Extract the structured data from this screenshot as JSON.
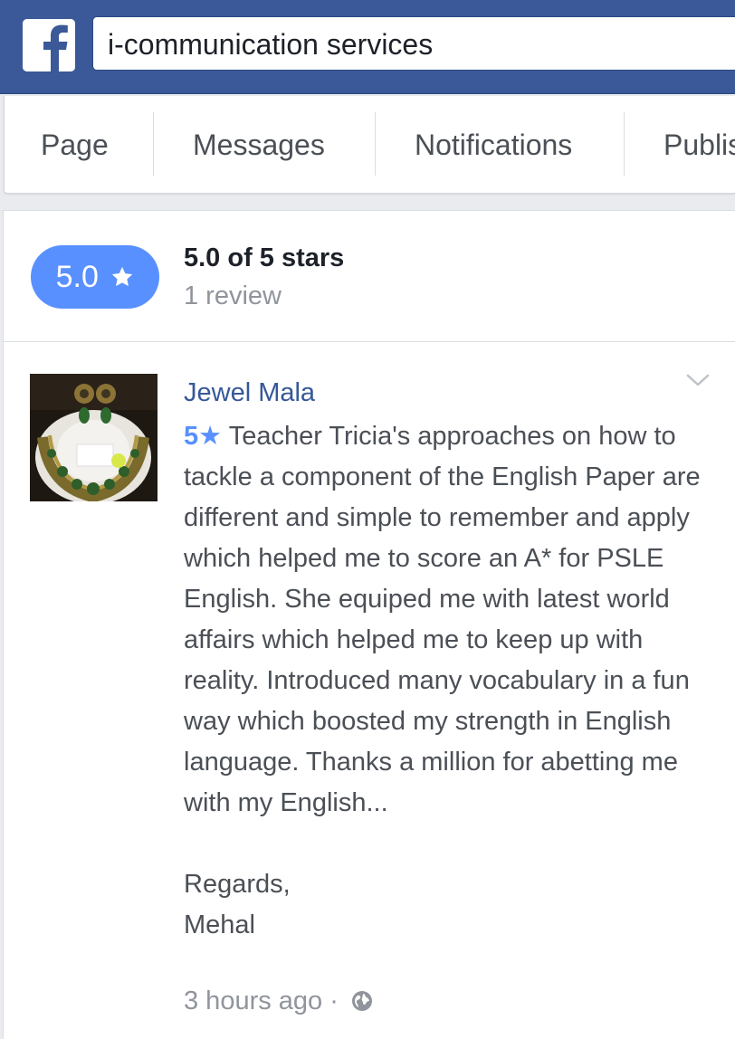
{
  "header": {
    "logo_icon": "facebook-f-logo",
    "search_value": "i-communication services",
    "brand_color": "#3b5998"
  },
  "tabs": [
    {
      "label": "Page"
    },
    {
      "label": "Messages"
    },
    {
      "label": "Notifications"
    },
    {
      "label": "Publis"
    }
  ],
  "rating": {
    "badge_value": "5.0",
    "badge_icon": "star-icon",
    "badge_color": "#5890ff",
    "title": "5.0 of 5 stars",
    "count": "1 review"
  },
  "review": {
    "reviewer_name": "Jewel Mala",
    "stars": "5",
    "star_glyph": "★",
    "body": "Teacher Tricia's approaches on how to tackle a component of the English Paper are different and simple to remember and apply which helped me to score an A* for PSLE English. She equiped me with latest world affairs which helped me to keep up with reality. Introduced many vocabulary in a fun way which boosted my strength in English language. Thanks a million for abetting me with my English...",
    "regards": "Regards,",
    "signature": "Mehal",
    "time": "3 hours ago",
    "separator": "·",
    "privacy_icon": "globe-icon",
    "menu_icon": "chevron-down-icon"
  }
}
